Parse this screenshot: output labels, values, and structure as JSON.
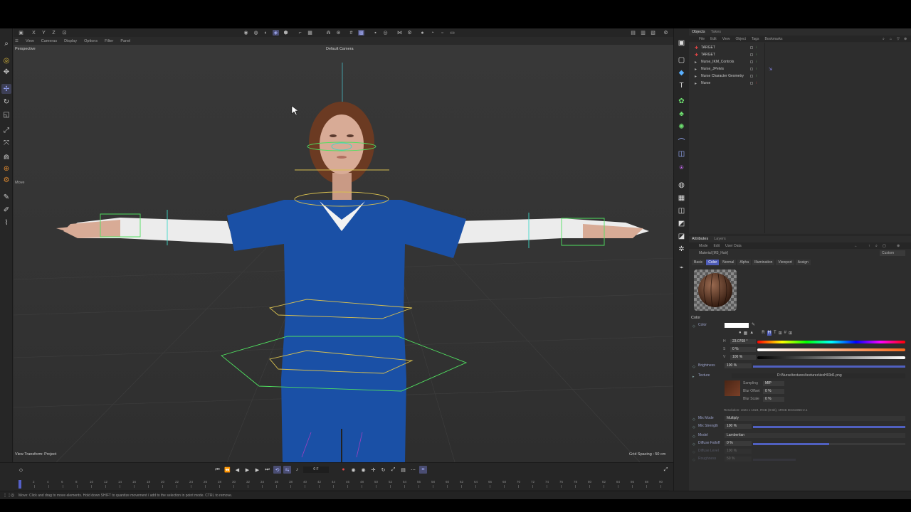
{
  "viewport": {
    "menu": [
      "View",
      "Cameras",
      "Display",
      "Options",
      "Filter",
      "Panel"
    ],
    "projection_label": "Perspective",
    "camera_label": "Default Camera",
    "move_label": "Move",
    "view_transform": "View Transform: Project",
    "grid_spacing": "Grid Spacing : 50 cm"
  },
  "objects_panel": {
    "tabs": [
      "Objects",
      "Takes"
    ],
    "menu": [
      "File",
      "Edit",
      "View",
      "Object",
      "Tags",
      "Bookmarks"
    ],
    "items": [
      "TARGET",
      "TARGET",
      "Nurse_IKM_Controls",
      "Nurse_JPelvis",
      "Nurse Character Geometry",
      "Nurse"
    ]
  },
  "attributes_panel": {
    "tabs": [
      "Attributes",
      "Layers"
    ],
    "menu": [
      "Mode",
      "Edit",
      "User Data"
    ],
    "material_name": "Material [M3_Hair]",
    "custom_label": "Custom",
    "material_tabs": [
      "Basic",
      "Color",
      "Normal",
      "Alpha",
      "Illumination",
      "Viewport",
      "Assign"
    ],
    "active_tab": "Color",
    "section_title": "Color",
    "color_label": "Color",
    "color_swatch": "#ffffff",
    "mode_letters": [
      "R",
      "H",
      "T",
      "#"
    ],
    "h_label": "H",
    "h_value": "23.0768 °",
    "s_label": "S",
    "s_value": "0 %",
    "v_label": "V",
    "v_value": "100 %",
    "brightness_label": "Brightness",
    "brightness_value": "100 %",
    "texture_label": "Texture",
    "texture_path": "D:\\Nurse\\textures\\textures\\texH03d1.png",
    "sampling_label": "Sampling",
    "sampling_value": "MIP",
    "blur_offset_label": "Blur Offset",
    "blur_offset_value": "0 %",
    "blur_scale_label": "Blur Scale",
    "blur_scale_value": "0 %",
    "resolution": "Resolution: 1024 x 1024, RGB (8 Bit), sRGB IEC61966-2.1",
    "mix_mode_label": "Mix Mode",
    "mix_mode_value": "Multiply",
    "mix_strength_label": "Mix Strength",
    "mix_strength_value": "100 %",
    "model_label": "Model",
    "model_value": "Lambertian",
    "diffuse_falloff_label": "Diffuse Falloff",
    "diffuse_falloff_value": "0 %",
    "diffuse_level_label": "Diffuse Level",
    "diffuse_level_value": "100 %",
    "roughness_label": "Roughness",
    "roughness_value": "50 %"
  },
  "timeline": {
    "current_frame": "0 F",
    "ticks": [
      "0",
      "2",
      "4",
      "6",
      "8",
      "10",
      "12",
      "14",
      "16",
      "18",
      "20",
      "22",
      "24",
      "26",
      "28",
      "30",
      "32",
      "34",
      "36",
      "38",
      "40",
      "42",
      "44",
      "46",
      "48",
      "50",
      "52",
      "54",
      "56",
      "58",
      "60",
      "62",
      "64",
      "66",
      "68",
      "70",
      "72",
      "74",
      "76",
      "78",
      "80",
      "82",
      "84",
      "86",
      "88",
      "90"
    ],
    "range_start": "0 F",
    "range_start2": "0 F",
    "range_end": "90 F",
    "range_end2": "90 F"
  },
  "status": {
    "message": "Move: Click and drag to move elements. Hold down SHIFT to quantize movement / add to the selection in point mode. CTRL to remove."
  },
  "colors": {
    "accent": "#4e5cb8",
    "scrubs": "#1850a8",
    "rig_yellow": "#d8c050",
    "rig_green": "#50e060",
    "rig_cyan": "#40d8c8"
  }
}
